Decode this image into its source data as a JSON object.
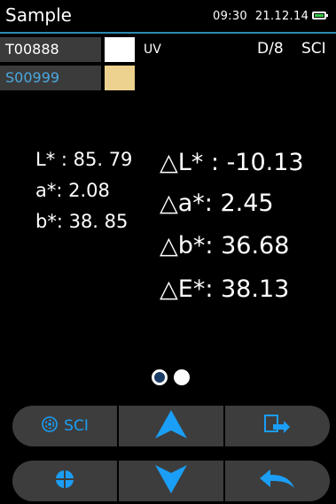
{
  "header": {
    "title": "Sample",
    "time": "09:30",
    "date": "21.12.14",
    "battery_level": 0.75,
    "battery_color": "#38c848"
  },
  "standard": {
    "id": "T00888",
    "swatch_color": "#ffffff"
  },
  "sample": {
    "id": "S00999",
    "swatch_color": "#ecd28e"
  },
  "modes": {
    "uv": "UV",
    "geometry": "D/8",
    "specular": "SCI"
  },
  "values": {
    "L": "L* : 85. 79",
    "a": "a*: 2.08",
    "b": "b*: 38. 85"
  },
  "differences": {
    "dL": "△L* : -10.13",
    "da": "△a*: 2.45",
    "db": "△b*: 36.68",
    "dE": "△E*: 38.13"
  },
  "pagination": {
    "current_page": 1,
    "total_pages": 2
  },
  "buttons": {
    "sci_label": "SCI",
    "sci_icon": "measure-mode-icon",
    "up_icon": "arrow-up-icon",
    "export_icon": "export-icon",
    "target_icon": "crosshair-icon",
    "down_icon": "arrow-down-icon",
    "back_icon": "back-icon"
  },
  "colors": {
    "accent": "#1b9ef5",
    "bar_bg": "#3d3d3d",
    "header_line": "#2a8bb0",
    "sample_text": "#4aa8e0"
  }
}
